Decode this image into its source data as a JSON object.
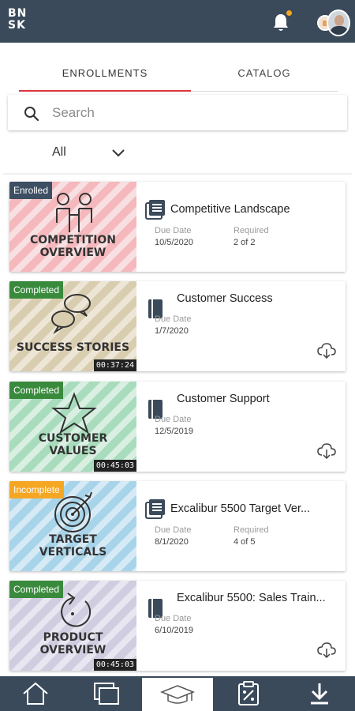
{
  "header": {
    "logo_line1": "BN",
    "logo_line2": "SK",
    "notification_dot_color": "#f5a623",
    "brand_color": "#3a4a5a"
  },
  "tabs": [
    {
      "label": "ENROLLMENTS",
      "active": true
    },
    {
      "label": "CATALOG",
      "active": false
    }
  ],
  "search": {
    "placeholder": "Search",
    "value": ""
  },
  "filter": {
    "selected": "All"
  },
  "courses": [
    {
      "status": "Enrolled",
      "status_color": "#3d4f63",
      "thumb_caption_line1": "COMPETITION",
      "thumb_caption_line2": "OVERVIEW",
      "thumb_color": "#f4b8bd",
      "thumb_art": "people-handshake",
      "duration": "",
      "type_icon": "course-list-icon",
      "title": "Competitive Landscape",
      "due_label": "Due Date",
      "due_date": "10/5/2020",
      "required_label": "Required",
      "required": "2 of 2",
      "downloadable": false
    },
    {
      "status": "Completed",
      "status_color": "#3a8a3e",
      "thumb_caption_line1": "SUCCESS STORIES",
      "thumb_caption_line2": "",
      "thumb_color": "#d9cdb0",
      "thumb_art": "speech-bubbles",
      "duration": "00:37:24",
      "type_icon": "book-icon",
      "title": "Customer Success",
      "due_label": "Due Date",
      "due_date": "1/7/2020",
      "required_label": "",
      "required": "",
      "downloadable": true
    },
    {
      "status": "Completed",
      "status_color": "#3a8a3e",
      "thumb_caption_line1": "CUSTOMER",
      "thumb_caption_line2": "VALUES",
      "thumb_color": "#a8dcbd",
      "thumb_art": "star",
      "duration": "00:45:03",
      "type_icon": "book-icon",
      "title": "Customer Support",
      "due_label": "Due Date",
      "due_date": "12/5/2019",
      "required_label": "",
      "required": "",
      "downloadable": true
    },
    {
      "status": "Incomplete",
      "status_color": "#f5a623",
      "thumb_caption_line1": "TARGET",
      "thumb_caption_line2": "VERTICALS",
      "thumb_color": "#a8d4ea",
      "thumb_art": "target",
      "duration": "",
      "type_icon": "course-list-icon",
      "title": "Excalibur 5500 Target Ver...",
      "due_label": "Due Date",
      "due_date": "8/1/2020",
      "required_label": "Required",
      "required": "4 of 5",
      "downloadable": false
    },
    {
      "status": "Completed",
      "status_color": "#3a8a3e",
      "thumb_caption_line1": "PRODUCT",
      "thumb_caption_line2": "OVERVIEW",
      "thumb_color": "#d0cde0",
      "thumb_art": "refresh-circle",
      "duration": "00:45:03",
      "type_icon": "book-icon",
      "title": "Excalibur 5500: Sales Train...",
      "due_label": "Due Date",
      "due_date": "6/10/2019",
      "required_label": "",
      "required": "",
      "downloadable": true
    }
  ],
  "bottom_nav": [
    {
      "icon": "home-icon",
      "active": false
    },
    {
      "icon": "library-icon",
      "active": false
    },
    {
      "icon": "graduation-cap-icon",
      "active": true
    },
    {
      "icon": "clipboard-icon",
      "active": false
    },
    {
      "icon": "download-icon",
      "active": false
    }
  ]
}
